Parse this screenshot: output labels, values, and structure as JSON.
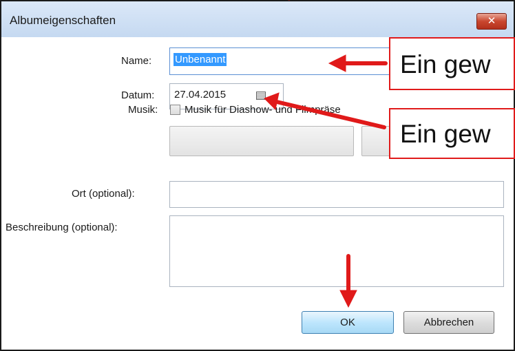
{
  "window": {
    "title": "Albumeigenschaften",
    "close_label": "✕"
  },
  "form": {
    "name_label": "Name:",
    "name_value": "Unbenannt",
    "date_label": "Datum:",
    "date_value": "27.04.2015",
    "music_label": "Musik:",
    "music_checkbox_label": "Musik für Diashow- und Filmpräse",
    "music_checked": false,
    "location_label": "Ort (optional):",
    "location_value": "",
    "description_label": "Beschreibung (optional):",
    "description_value": ""
  },
  "buttons": {
    "ok_label": "OK",
    "cancel_label": "Abbrechen"
  },
  "annotations": {
    "callout_name": "Ein gew",
    "callout_date": "Ein gew",
    "accent_color": "#e01a1a"
  },
  "colors": {
    "titlebar": "#c5d9f1",
    "close_button": "#c9472f",
    "selection": "#3399ff",
    "ok_button": "#bee6fd"
  }
}
